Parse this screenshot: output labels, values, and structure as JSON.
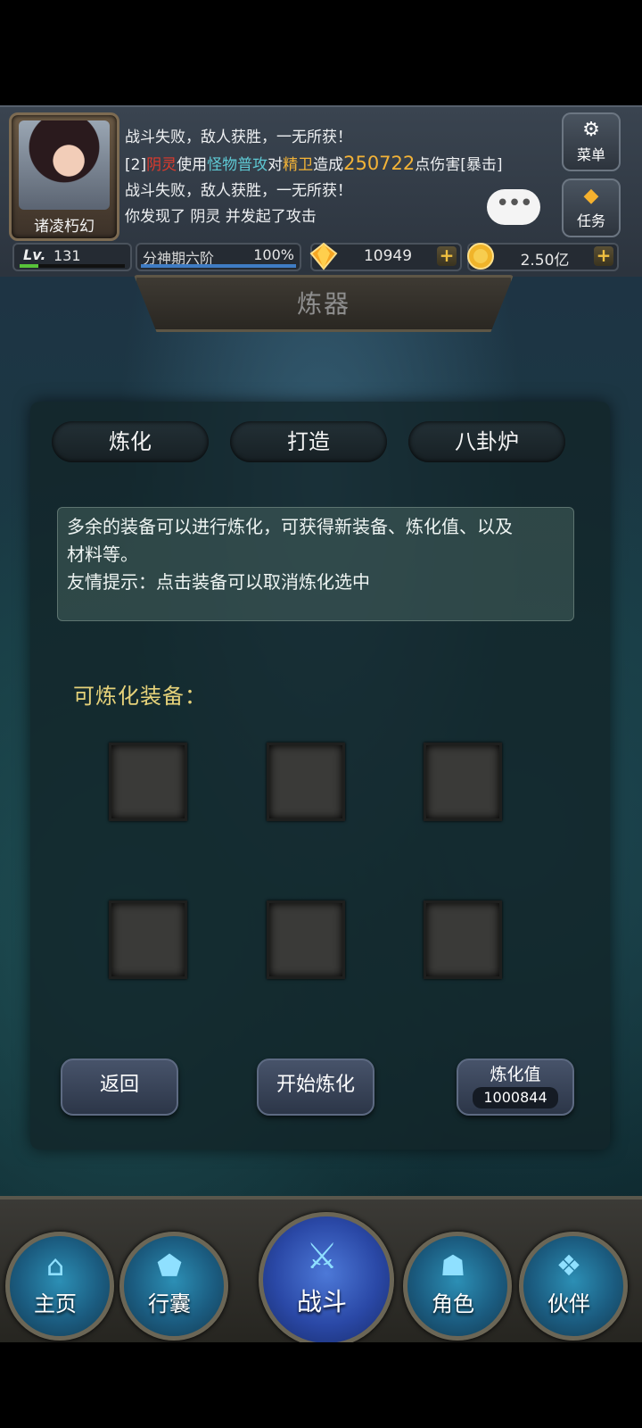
{
  "player": {
    "name": "诸凌朽幻",
    "level_label": "Lv.",
    "level": "131",
    "level_progress": 0.18,
    "realm": "分神期六阶",
    "realm_progress_text": "100%",
    "realm_progress": 1.0
  },
  "log": {
    "line1": "战斗失败，敌人获胜，一无所获！",
    "line2": {
      "prefix": "[2]",
      "enemy": "阴灵",
      "t1": "使用",
      "skill": "怪物普攻",
      "t2": "对",
      "target": "精卫",
      "t3": "造成",
      "damage": "250722",
      "t4": "点伤害[暴击]"
    },
    "line3": "战斗失败，敌人获胜，一无所获！",
    "line4": "你发现了 阴灵 并发起了攻击",
    "chat_glyph": "•••"
  },
  "side_buttons": {
    "menu": "菜单",
    "quest": "任务"
  },
  "currency": {
    "gems": "10949",
    "gold": "2.50亿",
    "plus": "+"
  },
  "page_title": "炼器",
  "tabs": [
    {
      "label": "炼化"
    },
    {
      "label": "打造"
    },
    {
      "label": "八卦炉"
    }
  ],
  "info": {
    "line1": "多余的装备可以进行炼化，可获得新装备、炼化值、以及",
    "line2": "材料等。",
    "line3": "友情提示：点击装备可以取消炼化选中"
  },
  "equip_title": "可炼化装备：",
  "slots": [
    {},
    {},
    {},
    {},
    {},
    {}
  ],
  "actions": {
    "back": "返回",
    "start": "开始炼化",
    "value_label": "炼化值",
    "value": "1000844"
  },
  "nav": [
    {
      "label": "主页"
    },
    {
      "label": "行囊"
    },
    {
      "label": "战斗"
    },
    {
      "label": "角色"
    },
    {
      "label": "伙伴"
    }
  ],
  "colors": {
    "enemy": "#e03a2c",
    "skill": "#5ec9d4",
    "damage": "#f3b337",
    "equip_title": "#e6d27a"
  }
}
